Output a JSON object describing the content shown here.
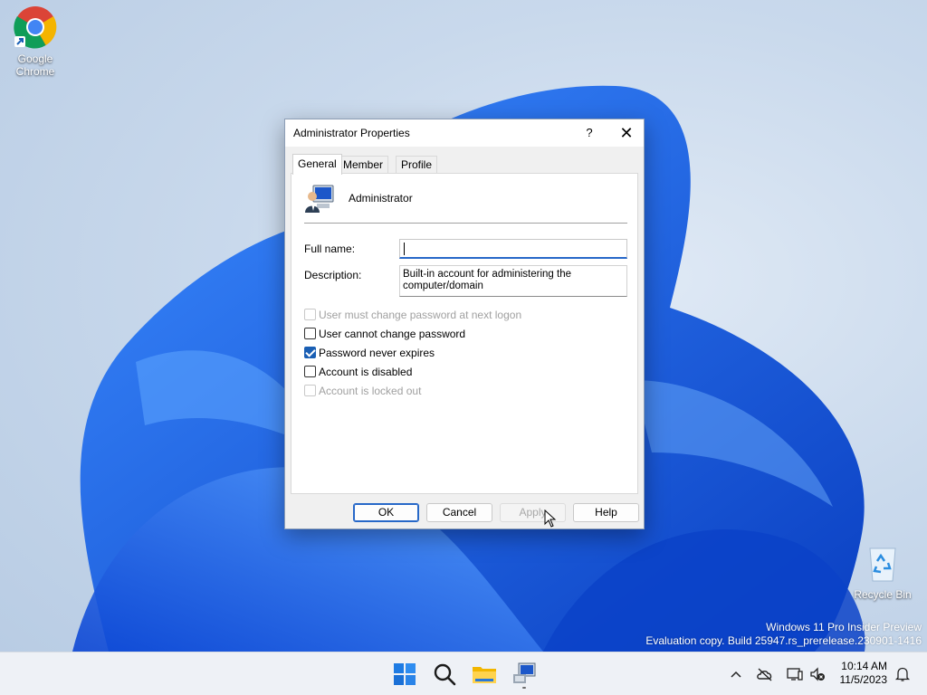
{
  "desktop": {
    "icons": [
      {
        "label": "Google Chrome",
        "icon": "chrome-icon"
      },
      {
        "label": "Recycle Bin",
        "icon": "recycle-bin-icon"
      }
    ],
    "watermark": {
      "line1": "Windows 11 Pro Insider Preview",
      "line2": "Evaluation copy. Build 25947.rs_prerelease.230901-1416"
    }
  },
  "dialog": {
    "title": "Administrator Properties",
    "help_label": "?",
    "close_label": "✕",
    "tabs": [
      {
        "label": "General",
        "active": true
      },
      {
        "label": "Member Of",
        "active": false
      },
      {
        "label": "Profile",
        "active": false
      }
    ],
    "user_name": "Administrator",
    "full_name": {
      "label": "Full name:",
      "value": ""
    },
    "description": {
      "label": "Description:",
      "value": "Built-in account for administering the computer/domain"
    },
    "checkboxes": [
      {
        "label": "User must change password at next logon",
        "checked": false,
        "enabled": false
      },
      {
        "label": "User cannot change password",
        "checked": false,
        "enabled": true
      },
      {
        "label": "Password never expires",
        "checked": true,
        "enabled": true
      },
      {
        "label": "Account is disabled",
        "checked": false,
        "enabled": true
      },
      {
        "label": "Account is locked out",
        "checked": false,
        "enabled": false
      }
    ],
    "buttons": {
      "ok": "OK",
      "cancel": "Cancel",
      "apply": "Apply",
      "help": "Help"
    }
  },
  "taskbar": {
    "apps": [
      "windows-start-icon",
      "search-icon",
      "file-explorer-icon",
      "computer-management-icon"
    ],
    "tray": [
      "chevron-up-icon",
      "onedrive-offline-icon",
      "network-icon",
      "volume-muted-icon",
      "notification-bell-icon"
    ],
    "clock": {
      "time": "10:14 AM",
      "date": "11/5/2023"
    }
  },
  "colors": {
    "accent": "#2768c8",
    "bloom": "#1660e8"
  }
}
